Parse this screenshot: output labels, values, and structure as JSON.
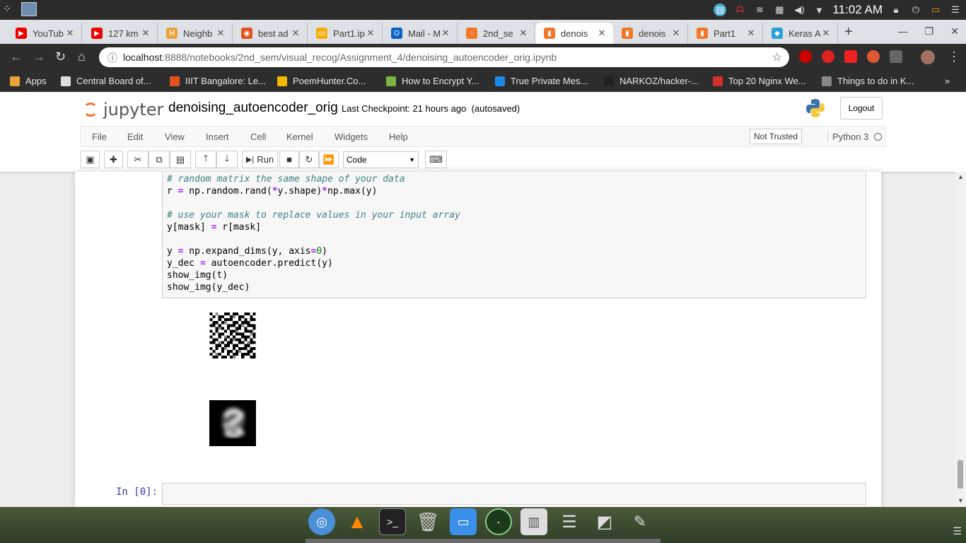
{
  "system": {
    "clock": "11:02 AM"
  },
  "tabs": [
    {
      "label": "YouTub",
      "fav": "#e00",
      "glyph": "▶"
    },
    {
      "label": "127 km",
      "fav": "#e00",
      "glyph": "▶"
    },
    {
      "label": "Neighb",
      "fav": "#e9a33b",
      "glyph": "M"
    },
    {
      "label": "best ad",
      "fav": "#e0531f",
      "glyph": "◉"
    },
    {
      "label": "Part1.ip",
      "fav": "#f9ab00",
      "glyph": "co"
    },
    {
      "label": "Mail - M",
      "fav": "#0a64c6",
      "glyph": "O"
    },
    {
      "label": "2nd_se",
      "fav": "#f37726",
      "glyph": "◌"
    },
    {
      "label": "denois",
      "fav": "#f37726",
      "glyph": "▮"
    },
    {
      "label": "denois",
      "fav": "#f37726",
      "glyph": "▮"
    },
    {
      "label": "Part1",
      "fav": "#f37726",
      "glyph": "▮"
    },
    {
      "label": "Keras A",
      "fav": "#2aa0d8",
      "glyph": "◆"
    }
  ],
  "address": {
    "host": "localhost",
    "path": ":8888/notebooks/2nd_sem/visual_recog/Assignment_4/denoising_autoencoder_orig.ipynb"
  },
  "bookmarks": [
    {
      "label": "Apps",
      "color": "#e8a33b"
    },
    {
      "label": "Central Board of...",
      "color": "#ddd"
    },
    {
      "label": "IIIT Bangalore: Le...",
      "color": "#e0531f"
    },
    {
      "label": "PoemHunter.Co...",
      "color": "#f5b800"
    },
    {
      "label": "How to Encrypt Y...",
      "color": "#7cb342"
    },
    {
      "label": "True Private Mes...",
      "color": "#1e88e5"
    },
    {
      "label": "NARKOZ/hacker-...",
      "color": "#222"
    },
    {
      "label": "Top 20 Nginx We...",
      "color": "#d32f2f"
    },
    {
      "label": "Things to do in K...",
      "color": "#888"
    }
  ],
  "jupyter": {
    "logo": "jupyter",
    "notebook_name": "denoising_autoencoder_orig",
    "checkpoint": "Last Checkpoint: 21 hours ago",
    "autosave": "(autosaved)",
    "logout": "Logout",
    "menus": [
      "File",
      "Edit",
      "View",
      "Insert",
      "Cell",
      "Kernel",
      "Widgets",
      "Help"
    ],
    "trust": "Not Trusted",
    "kernel": "Python 3",
    "run": "Run",
    "cell_type": "Code",
    "prompt": "In [0]:"
  }
}
